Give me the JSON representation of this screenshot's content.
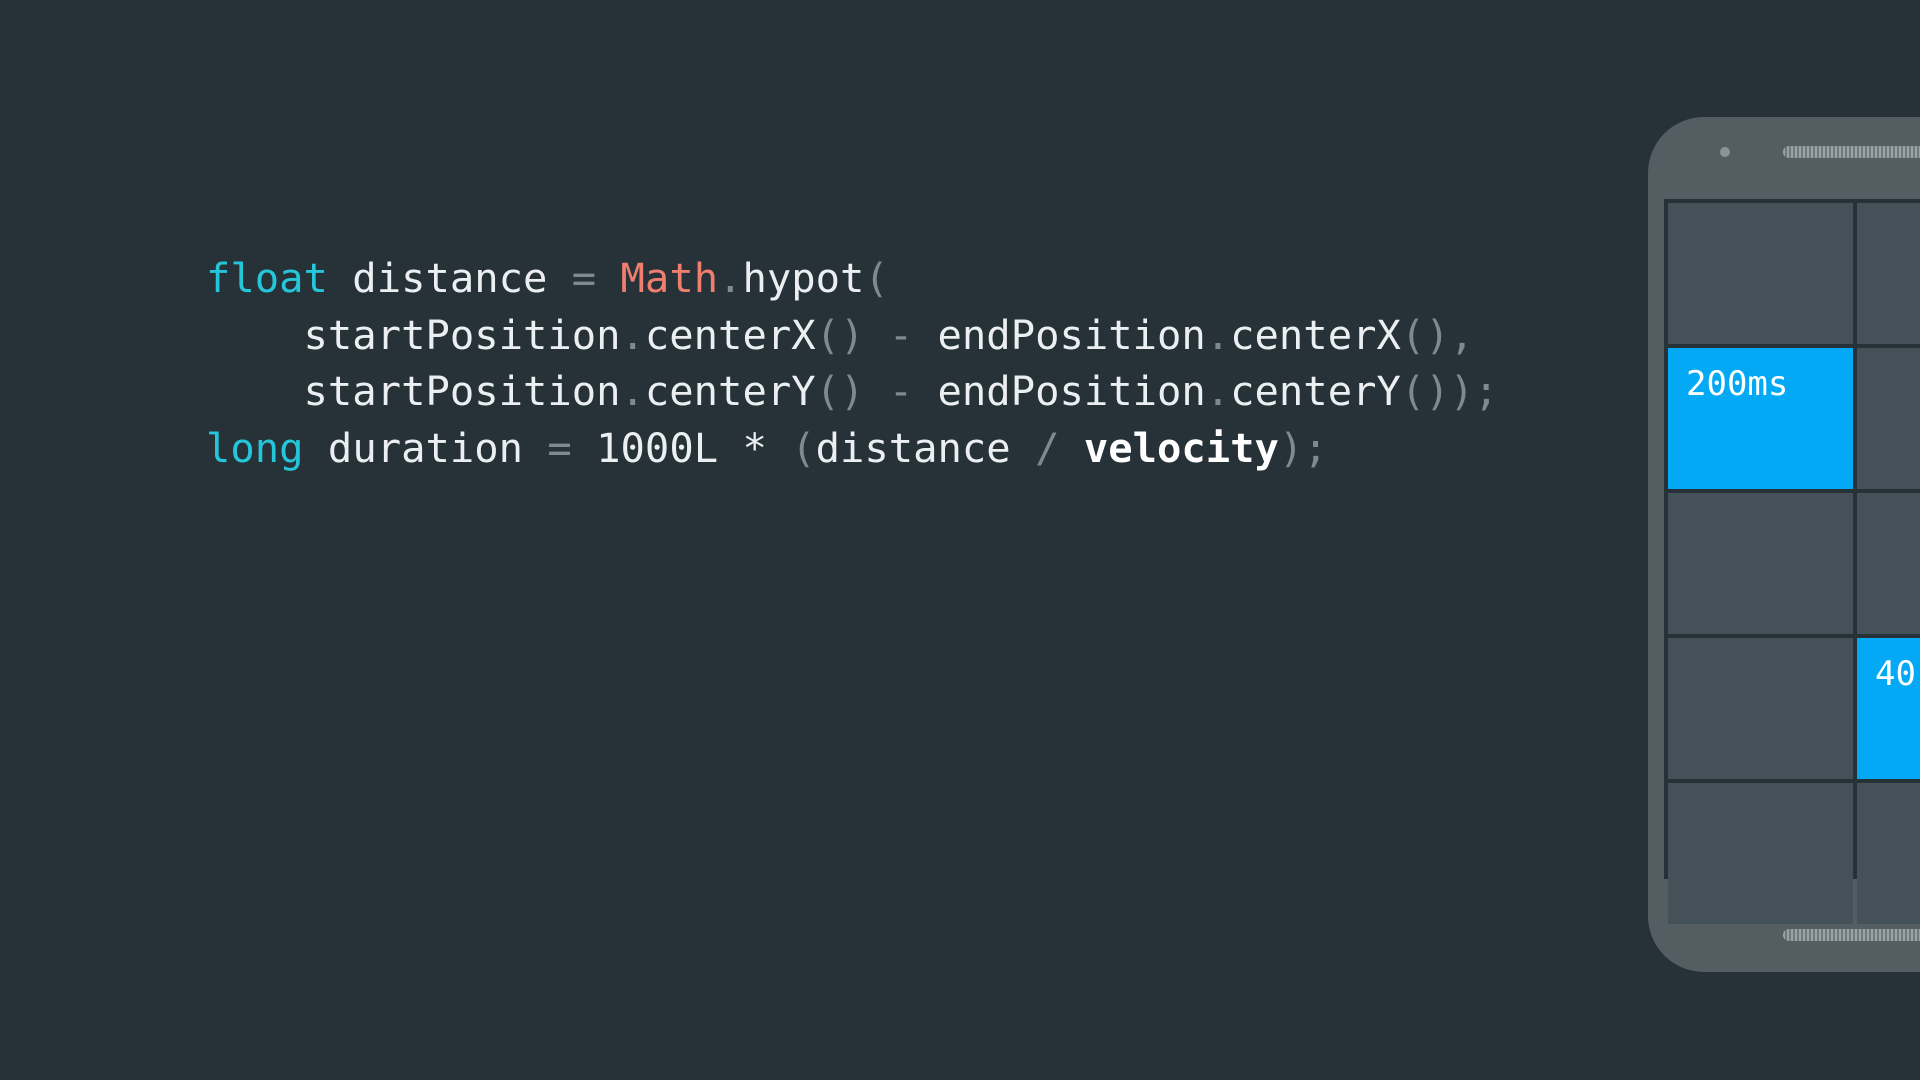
{
  "code": {
    "lines": [
      [
        {
          "t": "float",
          "k": "keyword"
        },
        {
          "t": " distance ",
          "k": "plain"
        },
        {
          "t": "=",
          "k": "punct"
        },
        {
          "t": " ",
          "k": "plain"
        },
        {
          "t": "Math",
          "k": "class"
        },
        {
          "t": ".",
          "k": "punct"
        },
        {
          "t": "hypot",
          "k": "plain"
        },
        {
          "t": "(",
          "k": "punct"
        }
      ],
      [
        {
          "t": "    startPosition",
          "k": "plain"
        },
        {
          "t": ".",
          "k": "punct"
        },
        {
          "t": "centerX",
          "k": "plain"
        },
        {
          "t": "()",
          "k": "punct"
        },
        {
          "t": " ",
          "k": "plain"
        },
        {
          "t": "-",
          "k": "punct"
        },
        {
          "t": " endPosition",
          "k": "plain"
        },
        {
          "t": ".",
          "k": "punct"
        },
        {
          "t": "centerX",
          "k": "plain"
        },
        {
          "t": "(),",
          "k": "punct"
        }
      ],
      [
        {
          "t": "    startPosition",
          "k": "plain"
        },
        {
          "t": ".",
          "k": "punct"
        },
        {
          "t": "centerY",
          "k": "plain"
        },
        {
          "t": "()",
          "k": "punct"
        },
        {
          "t": " ",
          "k": "plain"
        },
        {
          "t": "-",
          "k": "punct"
        },
        {
          "t": " endPosition",
          "k": "plain"
        },
        {
          "t": ".",
          "k": "punct"
        },
        {
          "t": "centerY",
          "k": "plain"
        },
        {
          "t": "());",
          "k": "punct"
        }
      ],
      [
        {
          "t": "long",
          "k": "keyword"
        },
        {
          "t": " duration ",
          "k": "plain"
        },
        {
          "t": "=",
          "k": "punct"
        },
        {
          "t": " 1000L * ",
          "k": "plain"
        },
        {
          "t": "(",
          "k": "punct"
        },
        {
          "t": "distance ",
          "k": "plain"
        },
        {
          "t": "/",
          "k": "punct"
        },
        {
          "t": " ",
          "k": "plain"
        },
        {
          "t": "velocity",
          "k": "bold"
        },
        {
          "t": ");",
          "k": "punct"
        }
      ]
    ]
  },
  "phone": {
    "tiles": [
      {
        "label": "",
        "active": false
      },
      {
        "label": "",
        "active": false
      },
      {
        "label": "200ms",
        "active": true
      },
      {
        "label": "",
        "active": false
      },
      {
        "label": "",
        "active": false
      },
      {
        "label": "",
        "active": false
      },
      {
        "label": "",
        "active": false
      },
      {
        "label": "40",
        "active": true
      },
      {
        "label": "",
        "active": false
      },
      {
        "label": "",
        "active": false
      }
    ]
  },
  "colors": {
    "background": "#263238",
    "keyword": "#26c6da",
    "class": "#f07e6e",
    "punct": "#7d8a91",
    "plain": "#eceff1",
    "tile": "#455159",
    "tile_active": "#03a9f4",
    "phone_body": "#535d62"
  }
}
